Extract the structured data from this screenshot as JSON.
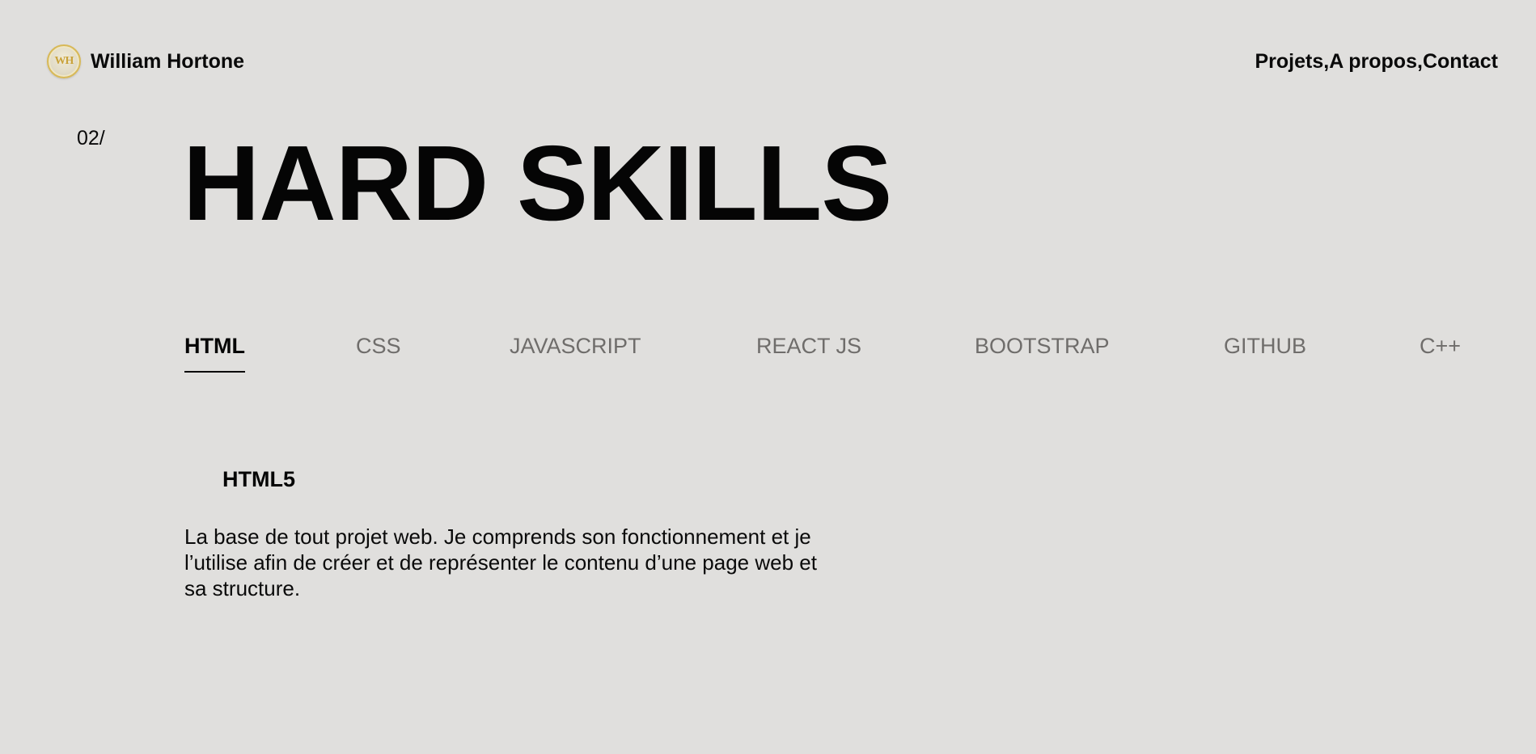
{
  "header": {
    "logo_text": "WH",
    "brand_name": "William Hortone",
    "nav": {
      "projets": "Projets",
      "apropos": "A propos",
      "contact": "Contact",
      "separator": ","
    }
  },
  "section": {
    "number": "02/",
    "title": "HARD SKILLS"
  },
  "tabs": [
    {
      "label": "HTML",
      "active": true
    },
    {
      "label": "CSS",
      "active": false
    },
    {
      "label": "JAVASCRIPT",
      "active": false
    },
    {
      "label": "REACT JS",
      "active": false
    },
    {
      "label": "BOOTSTRAP",
      "active": false
    },
    {
      "label": "GITHUB",
      "active": false
    },
    {
      "label": "C++",
      "active": false
    }
  ],
  "content": {
    "skill_title": "HTML5",
    "skill_description": "La base de tout projet web. Je comprends son fonctionnement et je l’utilise afin de créer et de représenter le contenu d’une page web et sa structure."
  },
  "colors": {
    "background": "#e0dfdd",
    "text": "#0a0a0a",
    "inactive_tab": "#6f6d6b",
    "logo_gold": "#d8b957"
  }
}
